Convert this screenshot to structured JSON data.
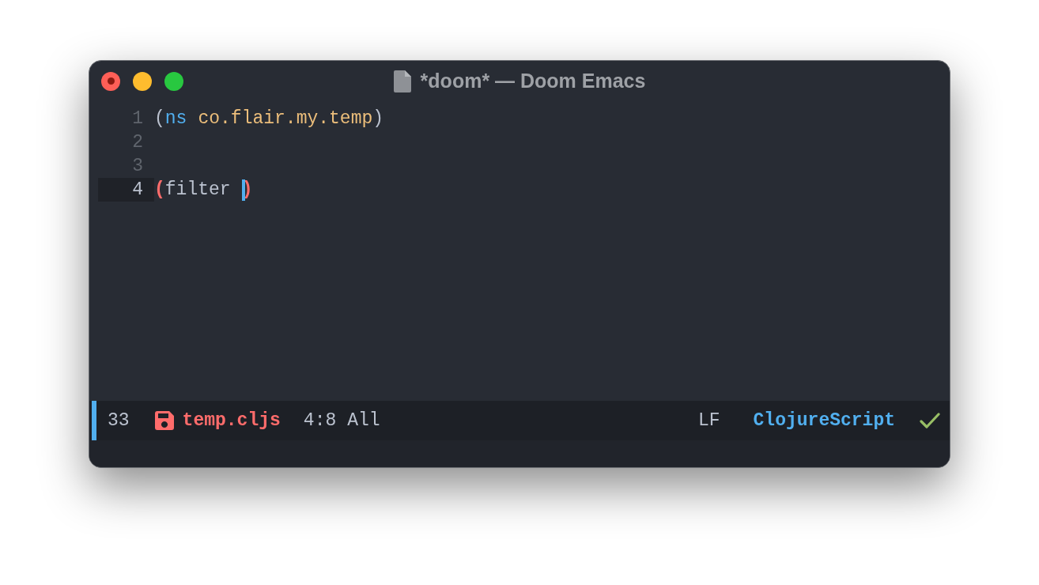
{
  "window": {
    "title": "*doom* — Doom Emacs",
    "unsaved": true
  },
  "editor": {
    "lines": [
      {
        "number": "1",
        "current": false,
        "tokens": [
          {
            "kind": "plain",
            "text": "("
          },
          {
            "kind": "keyword",
            "text": "ns"
          },
          {
            "kind": "namespace",
            "text": "co.flair.my.temp",
            "space_before": true
          },
          {
            "kind": "plain",
            "text": ")"
          }
        ]
      },
      {
        "number": "2",
        "current": false
      },
      {
        "number": "3",
        "current": false
      },
      {
        "number": "4",
        "current": true,
        "tokens": [
          {
            "kind": "match",
            "text": "("
          },
          {
            "kind": "plain",
            "text": "filter"
          },
          {
            "kind": "cursor",
            "space_before": true
          },
          {
            "kind": "match",
            "text": ")"
          }
        ]
      }
    ]
  },
  "mode_line": {
    "active": true,
    "size": "33",
    "modified": true,
    "file": "temp.cljs",
    "position": "4:8",
    "scroll": "All",
    "eol": "LF",
    "mode": "ClojureScript",
    "check_passed": true
  }
}
